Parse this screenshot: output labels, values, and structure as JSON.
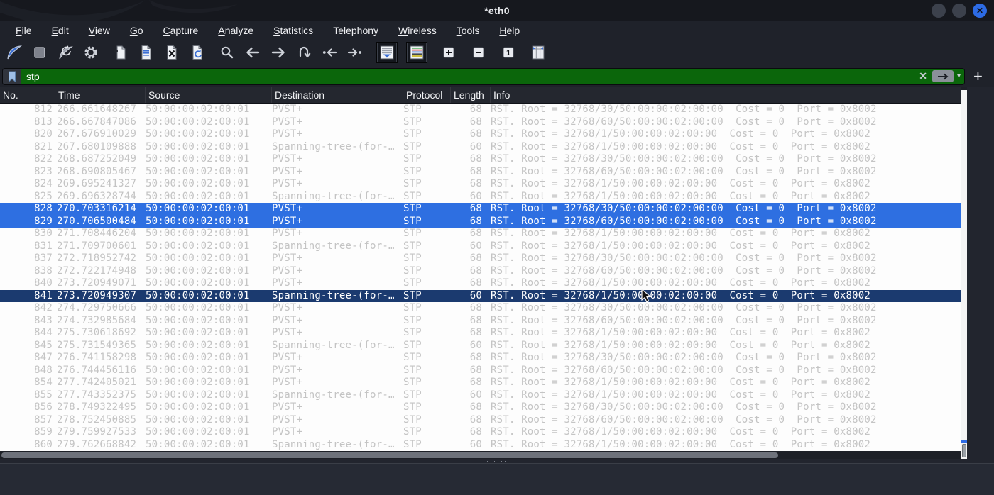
{
  "window": {
    "title": "*eth0"
  },
  "menu": {
    "items": [
      "File",
      "Edit",
      "View",
      "Go",
      "Capture",
      "Analyze",
      "Statistics",
      "Telephony",
      "Wireless",
      "Tools",
      "Help"
    ]
  },
  "toolbar": {
    "icons": [
      "start-capture-fin",
      "stop-capture",
      "restart-capture-fin",
      "capture-options-gear",
      "open-file",
      "save-file",
      "close-file",
      "reload-file",
      "find-packet-magnifier",
      "go-back-arrow",
      "go-forward-arrow",
      "go-to-packet",
      "go-first-packet",
      "go-last-packet",
      "auto-scroll-list",
      "colorize-packets",
      "zoom-in",
      "zoom-out",
      "zoom-original",
      "resize-columns"
    ]
  },
  "filter": {
    "value": "stp",
    "clear_label": "✕",
    "dropdown_caret": "▾",
    "add_button_label": "+"
  },
  "packet_table": {
    "columns": [
      "No.",
      "Time",
      "Source",
      "Destination",
      "Protocol",
      "Length",
      "Info"
    ],
    "rows": [
      {
        "no": "812",
        "time": "266.661648267",
        "source": "50:00:00:02:00:01",
        "destination": "PVST+",
        "protocol": "STP",
        "length": "68",
        "info": "RST. Root = 32768/30/50:00:00:02:00:00  Cost = 0  Port = 0x8002",
        "state": "normal"
      },
      {
        "no": "813",
        "time": "266.667847086",
        "source": "50:00:00:02:00:01",
        "destination": "PVST+",
        "protocol": "STP",
        "length": "68",
        "info": "RST. Root = 32768/60/50:00:00:02:00:00  Cost = 0  Port = 0x8002",
        "state": "normal"
      },
      {
        "no": "820",
        "time": "267.676910029",
        "source": "50:00:00:02:00:01",
        "destination": "PVST+",
        "protocol": "STP",
        "length": "68",
        "info": "RST. Root = 32768/1/50:00:00:02:00:00  Cost = 0  Port = 0x8002",
        "state": "normal"
      },
      {
        "no": "821",
        "time": "267.680109888",
        "source": "50:00:00:02:00:01",
        "destination": "Spanning-tree-(for-…",
        "protocol": "STP",
        "length": "60",
        "info": "RST. Root = 32768/1/50:00:00:02:00:00  Cost = 0  Port = 0x8002",
        "state": "normal"
      },
      {
        "no": "822",
        "time": "268.687252049",
        "source": "50:00:00:02:00:01",
        "destination": "PVST+",
        "protocol": "STP",
        "length": "68",
        "info": "RST. Root = 32768/30/50:00:00:02:00:00  Cost = 0  Port = 0x8002",
        "state": "normal"
      },
      {
        "no": "823",
        "time": "268.690805467",
        "source": "50:00:00:02:00:01",
        "destination": "PVST+",
        "protocol": "STP",
        "length": "68",
        "info": "RST. Root = 32768/60/50:00:00:02:00:00  Cost = 0  Port = 0x8002",
        "state": "normal"
      },
      {
        "no": "824",
        "time": "269.695241327",
        "source": "50:00:00:02:00:01",
        "destination": "PVST+",
        "protocol": "STP",
        "length": "68",
        "info": "RST. Root = 32768/1/50:00:00:02:00:00  Cost = 0  Port = 0x8002",
        "state": "normal"
      },
      {
        "no": "825",
        "time": "269.696328744",
        "source": "50:00:00:02:00:01",
        "destination": "Spanning-tree-(for-…",
        "protocol": "STP",
        "length": "60",
        "info": "RST. Root = 32768/1/50:00:00:02:00:00  Cost = 0  Port = 0x8002",
        "state": "normal"
      },
      {
        "no": "828",
        "time": "270.703316214",
        "source": "50:00:00:02:00:01",
        "destination": "PVST+",
        "protocol": "STP",
        "length": "68",
        "info": "RST. Root = 32768/30/50:00:00:02:00:00  Cost = 0  Port = 0x8002",
        "state": "selected"
      },
      {
        "no": "829",
        "time": "270.706500484",
        "source": "50:00:00:02:00:01",
        "destination": "PVST+",
        "protocol": "STP",
        "length": "68",
        "info": "RST. Root = 32768/60/50:00:00:02:00:00  Cost = 0  Port = 0x8002",
        "state": "selected"
      },
      {
        "no": "830",
        "time": "271.708446204",
        "source": "50:00:00:02:00:01",
        "destination": "PVST+",
        "protocol": "STP",
        "length": "68",
        "info": "RST. Root = 32768/1/50:00:00:02:00:00  Cost = 0  Port = 0x8002",
        "state": "normal"
      },
      {
        "no": "831",
        "time": "271.709700601",
        "source": "50:00:00:02:00:01",
        "destination": "Spanning-tree-(for-…",
        "protocol": "STP",
        "length": "60",
        "info": "RST. Root = 32768/1/50:00:00:02:00:00  Cost = 0  Port = 0x8002",
        "state": "normal"
      },
      {
        "no": "837",
        "time": "272.718952742",
        "source": "50:00:00:02:00:01",
        "destination": "PVST+",
        "protocol": "STP",
        "length": "68",
        "info": "RST. Root = 32768/30/50:00:00:02:00:00  Cost = 0  Port = 0x8002",
        "state": "normal"
      },
      {
        "no": "838",
        "time": "272.722174948",
        "source": "50:00:00:02:00:01",
        "destination": "PVST+",
        "protocol": "STP",
        "length": "68",
        "info": "RST. Root = 32768/60/50:00:00:02:00:00  Cost = 0  Port = 0x8002",
        "state": "normal"
      },
      {
        "no": "840",
        "time": "273.720949071",
        "source": "50:00:00:02:00:01",
        "destination": "PVST+",
        "protocol": "STP",
        "length": "68",
        "info": "RST. Root = 32768/1/50:00:00:02:00:00  Cost = 0  Port = 0x8002",
        "state": "normal"
      },
      {
        "no": "841",
        "time": "273.720949307",
        "source": "50:00:00:02:00:01",
        "destination": "Spanning-tree-(for-…",
        "protocol": "STP",
        "length": "60",
        "info": "RST. Root = 32768/1/50:00:00:02:00:00  Cost = 0  Port = 0x8002",
        "state": "selected_dark"
      },
      {
        "no": "842",
        "time": "274.729750666",
        "source": "50:00:00:02:00:01",
        "destination": "PVST+",
        "protocol": "STP",
        "length": "68",
        "info": "RST. Root = 32768/30/50:00:00:02:00:00  Cost = 0  Port = 0x8002",
        "state": "normal"
      },
      {
        "no": "843",
        "time": "274.732985684",
        "source": "50:00:00:02:00:01",
        "destination": "PVST+",
        "protocol": "STP",
        "length": "68",
        "info": "RST. Root = 32768/60/50:00:00:02:00:00  Cost = 0  Port = 0x8002",
        "state": "normal"
      },
      {
        "no": "844",
        "time": "275.730618692",
        "source": "50:00:00:02:00:01",
        "destination": "PVST+",
        "protocol": "STP",
        "length": "68",
        "info": "RST. Root = 32768/1/50:00:00:02:00:00  Cost = 0  Port = 0x8002",
        "state": "normal"
      },
      {
        "no": "845",
        "time": "275.731549365",
        "source": "50:00:00:02:00:01",
        "destination": "Spanning-tree-(for-…",
        "protocol": "STP",
        "length": "60",
        "info": "RST. Root = 32768/1/50:00:00:02:00:00  Cost = 0  Port = 0x8002",
        "state": "normal"
      },
      {
        "no": "847",
        "time": "276.741158298",
        "source": "50:00:00:02:00:01",
        "destination": "PVST+",
        "protocol": "STP",
        "length": "68",
        "info": "RST. Root = 32768/30/50:00:00:02:00:00  Cost = 0  Port = 0x8002",
        "state": "normal"
      },
      {
        "no": "848",
        "time": "276.744456116",
        "source": "50:00:00:02:00:01",
        "destination": "PVST+",
        "protocol": "STP",
        "length": "68",
        "info": "RST. Root = 32768/60/50:00:00:02:00:00  Cost = 0  Port = 0x8002",
        "state": "normal"
      },
      {
        "no": "854",
        "time": "277.742405021",
        "source": "50:00:00:02:00:01",
        "destination": "PVST+",
        "protocol": "STP",
        "length": "68",
        "info": "RST. Root = 32768/1/50:00:00:02:00:00  Cost = 0  Port = 0x8002",
        "state": "normal"
      },
      {
        "no": "855",
        "time": "277.743352375",
        "source": "50:00:00:02:00:01",
        "destination": "Spanning-tree-(for-…",
        "protocol": "STP",
        "length": "60",
        "info": "RST. Root = 32768/1/50:00:00:02:00:00  Cost = 0  Port = 0x8002",
        "state": "normal"
      },
      {
        "no": "856",
        "time": "278.749322495",
        "source": "50:00:00:02:00:01",
        "destination": "PVST+",
        "protocol": "STP",
        "length": "68",
        "info": "RST. Root = 32768/30/50:00:00:02:00:00  Cost = 0  Port = 0x8002",
        "state": "normal"
      },
      {
        "no": "857",
        "time": "278.752450885",
        "source": "50:00:00:02:00:01",
        "destination": "PVST+",
        "protocol": "STP",
        "length": "68",
        "info": "RST. Root = 32768/60/50:00:00:02:00:00  Cost = 0  Port = 0x8002",
        "state": "normal"
      },
      {
        "no": "859",
        "time": "279.759927533",
        "source": "50:00:00:02:00:01",
        "destination": "PVST+",
        "protocol": "STP",
        "length": "68",
        "info": "RST. Root = 32768/1/50:00:00:02:00:00  Cost = 0  Port = 0x8002",
        "state": "normal"
      },
      {
        "no": "860",
        "time": "279.762668842",
        "source": "50:00:00:02:00:01",
        "destination": "Spanning-tree-(for-…",
        "protocol": "STP",
        "length": "60",
        "info": "RST. Root = 32768/1/50:00:00:02:00:00  Cost = 0  Port = 0x8002",
        "state": "normal"
      }
    ]
  },
  "colors": {
    "filter_valid_bg": "#0b660b",
    "selection_primary": "#2e6fe1",
    "selection_secondary": "#1b3a6f",
    "row_text": "#c4c4c4",
    "close_button_blue": "#2d6be5",
    "accent_blue": "#3b6fd4"
  }
}
